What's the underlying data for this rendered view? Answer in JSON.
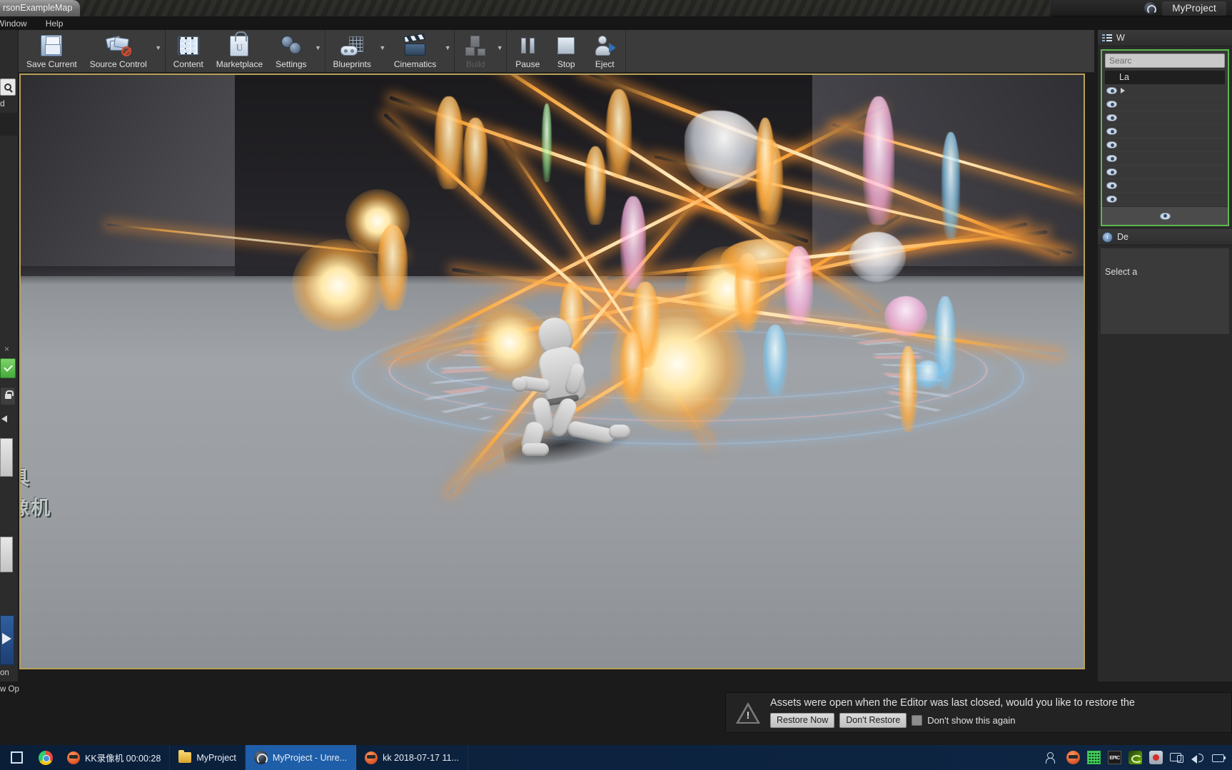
{
  "window": {
    "document_tab": "rsonExampleMap",
    "project_title": "MyProject",
    "ue_logo_icon": "unreal-engine-logo-icon"
  },
  "menubar": {
    "items": [
      {
        "label": "Window"
      },
      {
        "label": "Help"
      }
    ]
  },
  "toolbar": {
    "expander_icon": "chevron-double-right-icon",
    "groups": [
      {
        "buttons": [
          {
            "label": "Save Current",
            "icon": "floppy-disk-icon",
            "disabled": false,
            "has_caret": false
          },
          {
            "label": "Source Control",
            "icon": "source-control-folders-blocked-icon",
            "disabled": false,
            "has_caret": true
          }
        ]
      },
      {
        "buttons": [
          {
            "label": "Content",
            "icon": "content-browser-grid-icon",
            "disabled": false,
            "has_caret": false
          },
          {
            "label": "Marketplace",
            "icon": "marketplace-bag-icon",
            "disabled": false,
            "has_caret": false
          },
          {
            "label": "Settings",
            "icon": "gear-icon",
            "disabled": false,
            "has_caret": true
          }
        ]
      },
      {
        "buttons": [
          {
            "label": "Blueprints",
            "icon": "blueprint-gamepad-icon",
            "disabled": false,
            "has_caret": true
          },
          {
            "label": "Cinematics",
            "icon": "clapperboard-icon",
            "disabled": false,
            "has_caret": true
          }
        ]
      },
      {
        "buttons": [
          {
            "label": "Build",
            "icon": "build-boxes-icon",
            "disabled": true,
            "has_caret": true
          }
        ]
      },
      {
        "buttons": [
          {
            "label": "Pause",
            "icon": "pause-icon",
            "disabled": false,
            "has_caret": false
          },
          {
            "label": "Stop",
            "icon": "stop-square-icon",
            "disabled": false,
            "has_caret": false
          },
          {
            "label": "Eject",
            "icon": "eject-possess-icon",
            "disabled": false,
            "has_caret": false
          }
        ]
      }
    ]
  },
  "left_dock": {
    "search_icon": "magnifier-icon",
    "clipped_label": "d",
    "close_label": "×",
    "checkmark_icon": "green-check-icon",
    "lock_icon": "lock-icon",
    "triangle_icon": "collapse-triangle-icon",
    "bottom_label_1": "on",
    "bottom_label_2": "w Op"
  },
  "viewport": {
    "watermark_line1": "工具",
    "watermark_line2": "录像机",
    "scene_description": "Unreal Engine Play-In-Editor session: grey mannequin running in front of a glowing magic summoning circle with orange light beams and spawned glowing figures"
  },
  "notification": {
    "warning_icon": "warning-triangle-icon",
    "message": "Assets were open when the Editor was last closed, would you like to restore the",
    "restore_button": "Restore Now",
    "dont_restore_button": "Don't Restore",
    "checkbox_label": "Don't show this again",
    "checkbox_checked": false
  },
  "world_outliner": {
    "panel_icon": "world-outliner-icon",
    "title": "W",
    "search_placeholder": "Searc",
    "column_header": "La",
    "rows": [
      {
        "visible": true,
        "has_expander": true
      },
      {
        "visible": true,
        "has_expander": false
      },
      {
        "visible": true,
        "has_expander": false
      },
      {
        "visible": true,
        "has_expander": false
      },
      {
        "visible": true,
        "has_expander": false
      },
      {
        "visible": true,
        "has_expander": false
      },
      {
        "visible": true,
        "has_expander": false
      },
      {
        "visible": true,
        "has_expander": false
      },
      {
        "visible": true,
        "has_expander": false
      },
      {
        "visible": true,
        "has_expander": false
      }
    ],
    "footer_icon": "eye-icon"
  },
  "details_panel": {
    "panel_icon": "details-info-icon",
    "title": "De",
    "empty_text": "Select a"
  },
  "taskbar": {
    "start_icon": "windows-start-icon",
    "chrome_icon": "chrome-icon",
    "items": [
      {
        "label": "KK录像机 00:00:28",
        "icon": "kk-recorder-icon",
        "active": false
      },
      {
        "label": "MyProject",
        "icon": "folder-icon",
        "active": false
      },
      {
        "label": "MyProject - Unre...",
        "icon": "unreal-engine-icon",
        "active": true
      },
      {
        "label": "kk 2018-07-17 11...",
        "icon": "kk-recorder-icon",
        "active": false
      }
    ],
    "tray_icons": [
      "people-icon",
      "kk-recorder-tray-icon",
      "green-grid-icon",
      "epic-games-icon",
      "nvidia-icon",
      "screen-recorder-icon",
      "network-icon",
      "volume-icon",
      "battery-icon"
    ]
  },
  "colors": {
    "accent_beam": "#ffa43c",
    "viewport_border": "#b9a15a",
    "outliner_highlight": "#5db84f",
    "taskbar_active": "#1f5ea8"
  }
}
